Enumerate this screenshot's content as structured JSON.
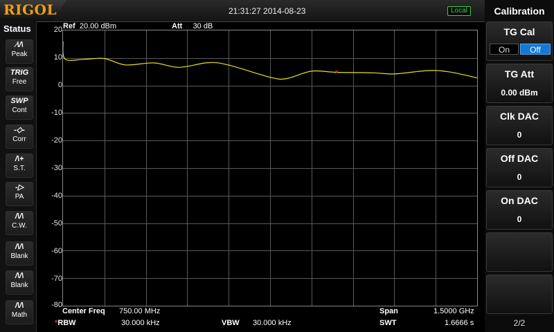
{
  "brand": "RIGOL",
  "datetime": "21:31:27 2014-08-23",
  "remote_state": "Local",
  "status_panel": {
    "title": "Status",
    "items": [
      {
        "icon": "peak-icon",
        "glyph": "⁄\\/\\",
        "label": "Peak",
        "state": "on"
      },
      {
        "icon": "trig-icon",
        "glyph": "TRIG",
        "label": "Free",
        "state": "on"
      },
      {
        "icon": "sweep-icon",
        "glyph": "SWP",
        "label": "Cont",
        "state": "on"
      },
      {
        "icon": "corr-icon",
        "glyph": "-◇-",
        "label": "Corr",
        "state": "dim"
      },
      {
        "icon": "st-icon",
        "glyph": "/\\+",
        "label": "S.T.",
        "state": "dim"
      },
      {
        "icon": "pa-icon",
        "glyph": "-▷",
        "label": "PA",
        "state": "dim"
      },
      {
        "icon": "cw-icon",
        "glyph": "/\\/\\",
        "label": "C.W.",
        "state": "yellow"
      },
      {
        "icon": "blank-icon",
        "glyph": "/\\/\\",
        "label": "Blank",
        "state": "dim"
      },
      {
        "icon": "blank-icon",
        "glyph": "/\\/\\",
        "label": "Blank",
        "state": "dim"
      },
      {
        "icon": "math-icon",
        "glyph": "/\\/\\",
        "label": "Math",
        "state": "dim"
      }
    ]
  },
  "header": {
    "ref_label": "Ref",
    "ref_value": "20.00 dBm",
    "att_label": "Att",
    "att_value": "30 dB"
  },
  "y_axis": {
    "ticks": [
      "20",
      "10",
      "0",
      "-10",
      "-20",
      "-30",
      "-40",
      "-50",
      "-60",
      "-70",
      "-80"
    ],
    "max_dbm": 20,
    "min_dbm": -80
  },
  "footer": {
    "center_freq_label": "Center Freq",
    "center_freq_value": "750.00 MHz",
    "span_label": "Span",
    "span_value": "1.5000 GHz",
    "rbw_label": "RBW",
    "rbw_value": "30.000 kHz",
    "vbw_label": "VBW",
    "vbw_value": "30.000 kHz",
    "swt_label": "SWT",
    "swt_value": "1.6666 s"
  },
  "colors": {
    "trace": "#e9e21a",
    "grid": "#5a5a5a",
    "marker": "#e23a3a",
    "accent": "#1478d6"
  },
  "trace": {
    "description_units": "frequency_fraction_vs_dBm",
    "points": [
      [
        0.0,
        16.0
      ],
      [
        0.005,
        9.6
      ],
      [
        0.05,
        9.5
      ],
      [
        0.1,
        9.8
      ],
      [
        0.15,
        7.5
      ],
      [
        0.22,
        8.2
      ],
      [
        0.28,
        6.6
      ],
      [
        0.35,
        8.3
      ],
      [
        0.4,
        7.4
      ],
      [
        0.5,
        3.0
      ],
      [
        0.54,
        2.5
      ],
      [
        0.6,
        5.2
      ],
      [
        0.66,
        4.8
      ],
      [
        0.75,
        4.6
      ],
      [
        0.8,
        4.2
      ],
      [
        0.88,
        5.4
      ],
      [
        0.93,
        5.0
      ],
      [
        1.0,
        2.8
      ]
    ],
    "marker_freq_fraction": 0.66,
    "marker_dbm": 5.0
  },
  "menu": {
    "title": "Calibration",
    "keys": [
      {
        "label": "TG Cal",
        "value": ""
      },
      {
        "label": "TG Att",
        "value": "0.00 dBm"
      },
      {
        "label": "Clk DAC",
        "value": "0"
      },
      {
        "label": "Off DAC",
        "value": "0"
      },
      {
        "label": "On DAC",
        "value": "0"
      },
      {
        "label": "",
        "value": ""
      },
      {
        "label": "",
        "value": ""
      }
    ],
    "tg_on_label": "On",
    "tg_off_label": "Off",
    "tg_selected": "Off",
    "page": "2/2"
  }
}
